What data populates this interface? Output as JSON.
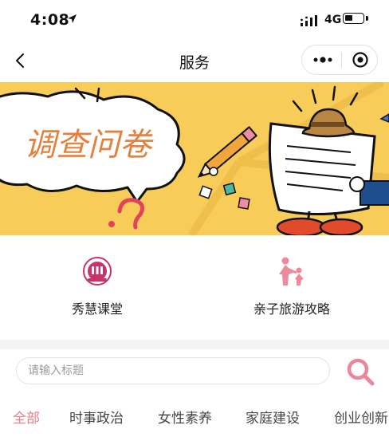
{
  "status_bar": {
    "time": "4:08",
    "network": "4G"
  },
  "nav": {
    "title": "服务"
  },
  "banner": {
    "title": "调查问卷"
  },
  "quick_links": [
    {
      "label": "秀慧课堂",
      "icon": "classroom-badge-icon"
    },
    {
      "label": "亲子旅游攻略",
      "icon": "parent-child-icon"
    }
  ],
  "search": {
    "placeholder": "请输入标题",
    "value": ""
  },
  "tabs": [
    {
      "label": "全部",
      "active": true
    },
    {
      "label": "时事政治",
      "active": false
    },
    {
      "label": "女性素养",
      "active": false
    },
    {
      "label": "家庭建设",
      "active": false
    },
    {
      "label": "创业创新",
      "active": false
    }
  ],
  "colors": {
    "accent": "#e87c8c",
    "banner_bg": "#f7cc59",
    "divider": "#f4f4f6"
  }
}
